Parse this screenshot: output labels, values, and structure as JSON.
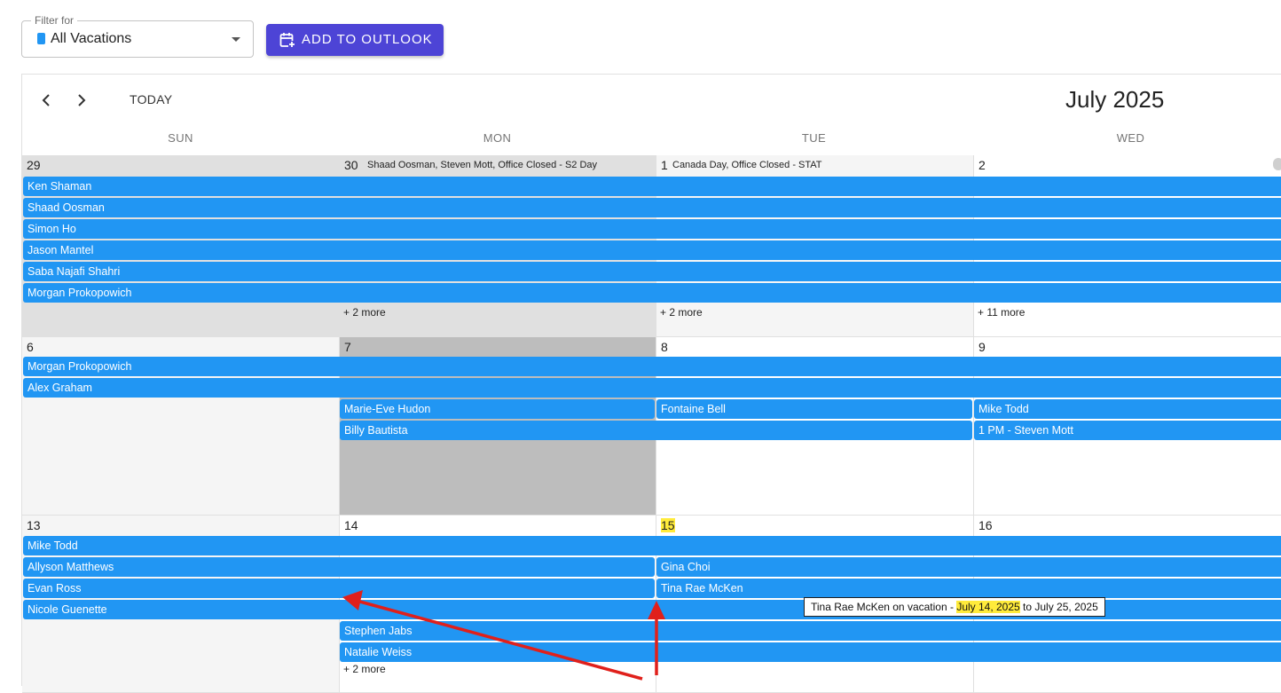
{
  "filter": {
    "legend": "Filter for",
    "value": "All Vacations",
    "swatch_color": "#2196f3"
  },
  "toolbar": {
    "add_to_outlook": "ADD TO OUTLOOK",
    "button_color": "#4d44d6"
  },
  "nav": {
    "today": "TODAY",
    "title": "July 2025"
  },
  "weekdays": [
    "SUN",
    "MON",
    "TUE",
    "WED"
  ],
  "week1": {
    "days": [
      "29",
      "30",
      "1",
      "2"
    ],
    "notes": {
      "mon": "Shaad Oosman, Steven Mott, Office Closed - S2 Day",
      "tue": "Canada Day, Office Closed - STAT"
    },
    "events": [
      "Ken Shaman",
      "Shaad Oosman",
      "Simon Ho",
      "Jason Mantel",
      "Saba Najafi Shahri",
      "Morgan Prokopowich"
    ],
    "more": {
      "mon": "+ 2 more",
      "tue": "+ 2 more",
      "wed": "+ 11 more"
    }
  },
  "week2": {
    "days": [
      "6",
      "7",
      "8",
      "9"
    ],
    "events": {
      "e1": "Morgan Prokopowich",
      "e2": "Alex Graham",
      "e3": "Marie-Eve Hudon",
      "e4": "Fontaine Bell",
      "e5": "Mike Todd",
      "e6": "Billy Bautista",
      "e7": "1 PM - Steven Mott"
    }
  },
  "week3": {
    "days": [
      "13",
      "14",
      "15",
      "16"
    ],
    "events": {
      "e1": "Mike Todd",
      "e2": "Allyson Matthews",
      "e3": "Gina Choi",
      "e4": "Evan Ross",
      "e5": "Tina Rae McKen",
      "e6": "Nicole Guenette",
      "e7": "Stephen Jabs",
      "e8": "Natalie Weiss"
    },
    "more": {
      "mon": "+ 2 more"
    }
  },
  "tooltip": {
    "prefix": "Tina Rae McKen on vacation - ",
    "start": "July 14, 2025",
    "suffix": " to July 25, 2025"
  },
  "colors": {
    "event": "#2196f3",
    "today_highlight": "#ffeb3b",
    "past_day": "#f5f5f5",
    "selected_day": "#bdbdbd",
    "annotation_arrow": "#e0201b"
  }
}
